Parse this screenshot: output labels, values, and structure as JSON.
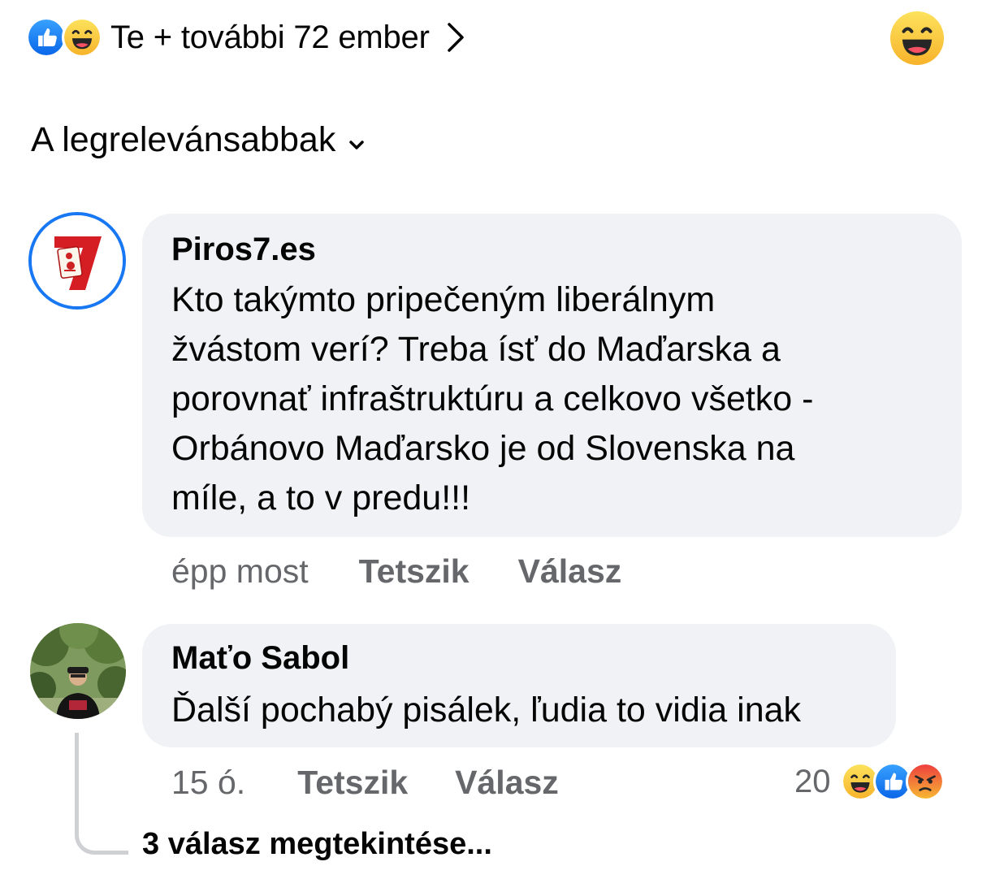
{
  "reactions_header": {
    "icons": [
      "like-icon",
      "haha-icon"
    ],
    "text": "Te + további 72 ember",
    "right_icon": "haha-icon"
  },
  "sort": {
    "label": "A legrelevánsabbak"
  },
  "comments": [
    {
      "author": "Piros7.es",
      "text": "Kto takýmto pripečeným liberálnym\nžvástom verí? Treba ísť do Maďarska a\nporovnať infraštruktúru a celkovo všetko -\nOrbánovo Maďarsko je od Slovenska na\nmíle, a to v predu!!!",
      "time": "épp most",
      "like_label": "Tetszik",
      "reply_label": "Válasz",
      "avatar_text": "7"
    },
    {
      "author": "Maťo Sabol",
      "text": "Ďalší pochabý pisálek, ľudia to vidia inak",
      "time": "15 ó.",
      "like_label": "Tetszik",
      "reply_label": "Válasz",
      "reaction_count": "20",
      "reaction_icons": [
        "haha-icon",
        "like-icon",
        "angry-icon"
      ],
      "view_replies": "3 válasz megtekintése..."
    }
  ],
  "colors": {
    "like_blue": "#1877f2",
    "haha_yellow": "#fcd535",
    "angry_orange": "#f25c2a",
    "bubble_bg": "#f0f2f5",
    "meta_gray": "#65676b"
  }
}
